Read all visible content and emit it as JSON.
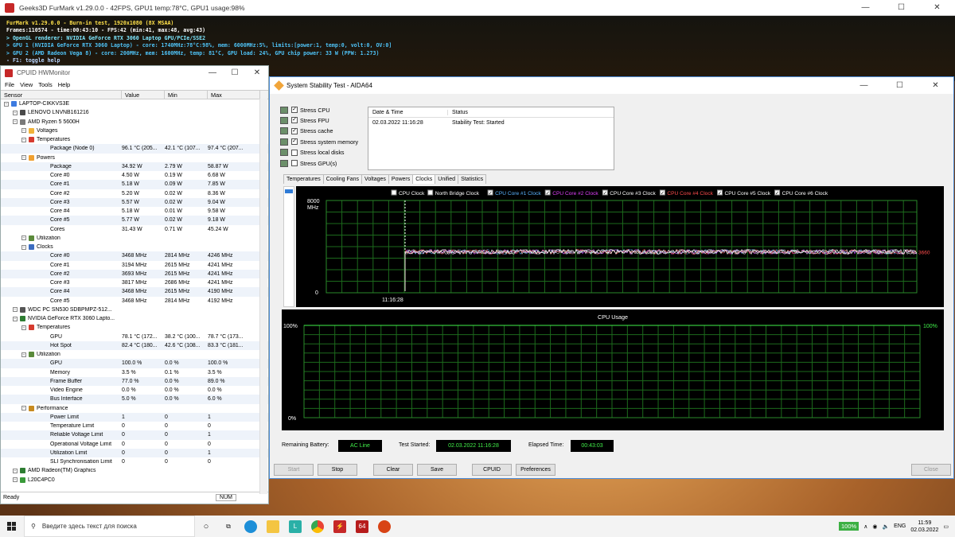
{
  "furmark": {
    "title": "Geeks3D FurMark v1.29.0.0 - 42FPS, GPU1 temp:78°C, GPU1 usage:98%",
    "hud": [
      "FurMark v1.29.0.0 - Burn-in test, 1920x1080 (8X MSAA)",
      "Frames:110574 - time:00:43:10 - FPS:42 (min:41, max:48, avg:43)",
      "> OpenGL renderer: NVIDIA GeForce RTX 3060 Laptop GPU/PCIe/SSE2",
      "> GPU 1 (NVIDIA GeForce RTX 3060 Laptop) - core: 1740MHz:78°C:98%, mem: 6000MHz:5%, limits:[power:1, temp:0, volt:0, OV:0]",
      "> GPU 2 (AMD Radeon Vega 8) - core: 200MHz, mem: 1600MHz, temp: 81°C, GPU load: 24%, GPU chip power: 33 W (PPW: 1.273)",
      "- F1: toggle help"
    ]
  },
  "hwmonitor": {
    "title": "CPUID HWMonitor",
    "menu": [
      "File",
      "View",
      "Tools",
      "Help"
    ],
    "columns": [
      "Sensor",
      "Value",
      "Min",
      "Max"
    ],
    "rows": [
      {
        "d": 0,
        "name": "LAPTOP-CIKKVS3E",
        "v": "",
        "mi": "",
        "ma": "",
        "ic": "pc"
      },
      {
        "d": 1,
        "name": "LENOVO LNVNB161216",
        "v": "",
        "mi": "",
        "ma": "",
        "ic": "board"
      },
      {
        "d": 1,
        "name": "AMD Ryzen 5 5600H",
        "v": "",
        "mi": "",
        "ma": "",
        "ic": "chip"
      },
      {
        "d": 2,
        "name": "Voltages",
        "v": "",
        "mi": "",
        "ma": "",
        "ic": "volt"
      },
      {
        "d": 2,
        "name": "Temperatures",
        "v": "",
        "mi": "",
        "ma": "",
        "ic": "temp"
      },
      {
        "d": 3,
        "name": "Package (Node 0)",
        "v": "96.1 °C  (205...",
        "mi": "42.1 °C  (107...",
        "ma": "97.4 °C  (207..."
      },
      {
        "d": 2,
        "name": "Powers",
        "v": "",
        "mi": "",
        "ma": "",
        "ic": "power"
      },
      {
        "d": 3,
        "name": "Package",
        "v": "34.92 W",
        "mi": "2.79 W",
        "ma": "58.87 W"
      },
      {
        "d": 3,
        "name": "Core #0",
        "v": "4.50 W",
        "mi": "0.19 W",
        "ma": "6.68 W"
      },
      {
        "d": 3,
        "name": "Core #1",
        "v": "5.18 W",
        "mi": "0.09 W",
        "ma": "7.85 W"
      },
      {
        "d": 3,
        "name": "Core #2",
        "v": "5.20 W",
        "mi": "0.02 W",
        "ma": "8.36 W"
      },
      {
        "d": 3,
        "name": "Core #3",
        "v": "5.57 W",
        "mi": "0.02 W",
        "ma": "9.04 W"
      },
      {
        "d": 3,
        "name": "Core #4",
        "v": "5.18 W",
        "mi": "0.01 W",
        "ma": "9.58 W"
      },
      {
        "d": 3,
        "name": "Core #5",
        "v": "5.77 W",
        "mi": "0.02 W",
        "ma": "9.18 W"
      },
      {
        "d": 3,
        "name": "Cores",
        "v": "31.43 W",
        "mi": "0.71 W",
        "ma": "45.24 W"
      },
      {
        "d": 2,
        "name": "Utilization",
        "v": "",
        "mi": "",
        "ma": "",
        "ic": "util"
      },
      {
        "d": 2,
        "name": "Clocks",
        "v": "",
        "mi": "",
        "ma": "",
        "ic": "clock"
      },
      {
        "d": 3,
        "name": "Core #0",
        "v": "3468 MHz",
        "mi": "2814 MHz",
        "ma": "4246 MHz"
      },
      {
        "d": 3,
        "name": "Core #1",
        "v": "3194 MHz",
        "mi": "2615 MHz",
        "ma": "4241 MHz"
      },
      {
        "d": 3,
        "name": "Core #2",
        "v": "3693 MHz",
        "mi": "2615 MHz",
        "ma": "4241 MHz"
      },
      {
        "d": 3,
        "name": "Core #3",
        "v": "3817 MHz",
        "mi": "2686 MHz",
        "ma": "4241 MHz"
      },
      {
        "d": 3,
        "name": "Core #4",
        "v": "3468 MHz",
        "mi": "2615 MHz",
        "ma": "4190 MHz"
      },
      {
        "d": 3,
        "name": "Core #5",
        "v": "3468 MHz",
        "mi": "2814 MHz",
        "ma": "4192 MHz"
      },
      {
        "d": 1,
        "name": "WDC PC SN530 SDBPMPZ-512...",
        "v": "",
        "mi": "",
        "ma": "",
        "ic": "disk"
      },
      {
        "d": 1,
        "name": "NVIDIA GeForce RTX 3060 Lapto...",
        "v": "",
        "mi": "",
        "ma": "",
        "ic": "gpu"
      },
      {
        "d": 2,
        "name": "Temperatures",
        "v": "",
        "mi": "",
        "ma": "",
        "ic": "temp"
      },
      {
        "d": 3,
        "name": "GPU",
        "v": "78.1 °C  (172...",
        "mi": "38.2 °C  (100...",
        "ma": "78.7 °C  (173..."
      },
      {
        "d": 3,
        "name": "Hot Spot",
        "v": "82.4 °C  (180...",
        "mi": "42.6 °C  (108...",
        "ma": "83.3 °C  (181..."
      },
      {
        "d": 2,
        "name": "Utilization",
        "v": "",
        "mi": "",
        "ma": "",
        "ic": "util"
      },
      {
        "d": 3,
        "name": "GPU",
        "v": "100.0 %",
        "mi": "0.0 %",
        "ma": "100.0 %"
      },
      {
        "d": 3,
        "name": "Memory",
        "v": "3.5 %",
        "mi": "0.1 %",
        "ma": "3.5 %"
      },
      {
        "d": 3,
        "name": "Frame Buffer",
        "v": "77.0 %",
        "mi": "0.0 %",
        "ma": "89.0 %"
      },
      {
        "d": 3,
        "name": "Video Engine",
        "v": "0.0 %",
        "mi": "0.0 %",
        "ma": "0.0 %"
      },
      {
        "d": 3,
        "name": "Bus Interface",
        "v": "5.0 %",
        "mi": "0.0 %",
        "ma": "6.0 %"
      },
      {
        "d": 2,
        "name": "Performance",
        "v": "",
        "mi": "",
        "ma": "",
        "ic": "perf"
      },
      {
        "d": 3,
        "name": "Power Limit",
        "v": "1",
        "mi": "0",
        "ma": "1"
      },
      {
        "d": 3,
        "name": "Temperature Limit",
        "v": "0",
        "mi": "0",
        "ma": "0"
      },
      {
        "d": 3,
        "name": "Reliable Voltage Limit",
        "v": "0",
        "mi": "0",
        "ma": "1"
      },
      {
        "d": 3,
        "name": "Operational Voltage Limit",
        "v": "0",
        "mi": "0",
        "ma": "0"
      },
      {
        "d": 3,
        "name": "Utilization Limit",
        "v": "0",
        "mi": "0",
        "ma": "1"
      },
      {
        "d": 3,
        "name": "SLI Synchronisation Limit",
        "v": "0",
        "mi": "0",
        "ma": "0"
      },
      {
        "d": 1,
        "name": "AMD Radeon(TM) Graphics",
        "v": "",
        "mi": "",
        "ma": "",
        "ic": "gpu"
      },
      {
        "d": 1,
        "name": "L20C4PC0",
        "v": "",
        "mi": "",
        "ma": "",
        "ic": "battery"
      }
    ],
    "status": "Ready",
    "num": "NUM"
  },
  "aida": {
    "title": "System Stability Test - AIDA64",
    "stress": [
      {
        "label": "Stress CPU",
        "checked": true
      },
      {
        "label": "Stress FPU",
        "checked": true
      },
      {
        "label": "Stress cache",
        "checked": true
      },
      {
        "label": "Stress system memory",
        "checked": true
      },
      {
        "label": "Stress local disks",
        "checked": false
      },
      {
        "label": "Stress GPU(s)",
        "checked": false
      }
    ],
    "status_headers": [
      "Date & Time",
      "Status"
    ],
    "status_rows": [
      {
        "dt": "02.03.2022 11:16:28",
        "st": "Stability Test: Started"
      }
    ],
    "tabs": [
      "Temperatures",
      "Cooling Fans",
      "Voltages",
      "Powers",
      "Clocks",
      "Unified",
      "Statistics"
    ],
    "active_tab": "Clocks",
    "remaining_battery_label": "Remaining Battery:",
    "remaining_battery": "AC Line",
    "test_started_label": "Test Started:",
    "test_started": "02.03.2022 11:16:28",
    "elapsed_label": "Elapsed Time:",
    "elapsed": "00:43:03",
    "buttons": [
      "Start",
      "Stop",
      "Clear",
      "Save",
      "CPUID",
      "Preferences",
      "Close"
    ]
  },
  "chart_data": [
    {
      "type": "line",
      "legend": [
        {
          "name": "CPU Clock",
          "checked": false,
          "color": "#ffffff"
        },
        {
          "name": "North Bridge Clock",
          "checked": false,
          "color": "#ffffff"
        },
        {
          "name": "CPU Core #1 Clock",
          "checked": true,
          "color": "#5ab4ff"
        },
        {
          "name": "CPU Core #2 Clock",
          "checked": true,
          "color": "#e040fb"
        },
        {
          "name": "CPU Core #3 Clock",
          "checked": true,
          "color": "#ffffff"
        },
        {
          "name": "CPU Core #4 Clock",
          "checked": true,
          "color": "#ff4d4d"
        },
        {
          "name": "CPU Core #5 Clock",
          "checked": true,
          "color": "#ffffff"
        },
        {
          "name": "CPU Core #6 Clock",
          "checked": true,
          "color": "#ffffff"
        }
      ],
      "ylabel_top": "8000",
      "ylabel_unit": "MHz",
      "ylabel_bottom": "0",
      "ylim": [
        0,
        8000
      ],
      "x_marker_label": "11:16:28",
      "right_value": "3660",
      "series_level_mhz": 3550,
      "grid": true
    },
    {
      "type": "line",
      "title": "CPU Usage",
      "ylabel_top": "100%",
      "ylabel_bottom": "0%",
      "right_label": "100%",
      "ylim": [
        0,
        100
      ],
      "grid": true
    }
  ],
  "taskbar": {
    "search_placeholder": "Введите здесь текст для поиска",
    "battery": "100%",
    "lang": "ENG",
    "time": "11:59",
    "date": "02.03.2022"
  }
}
